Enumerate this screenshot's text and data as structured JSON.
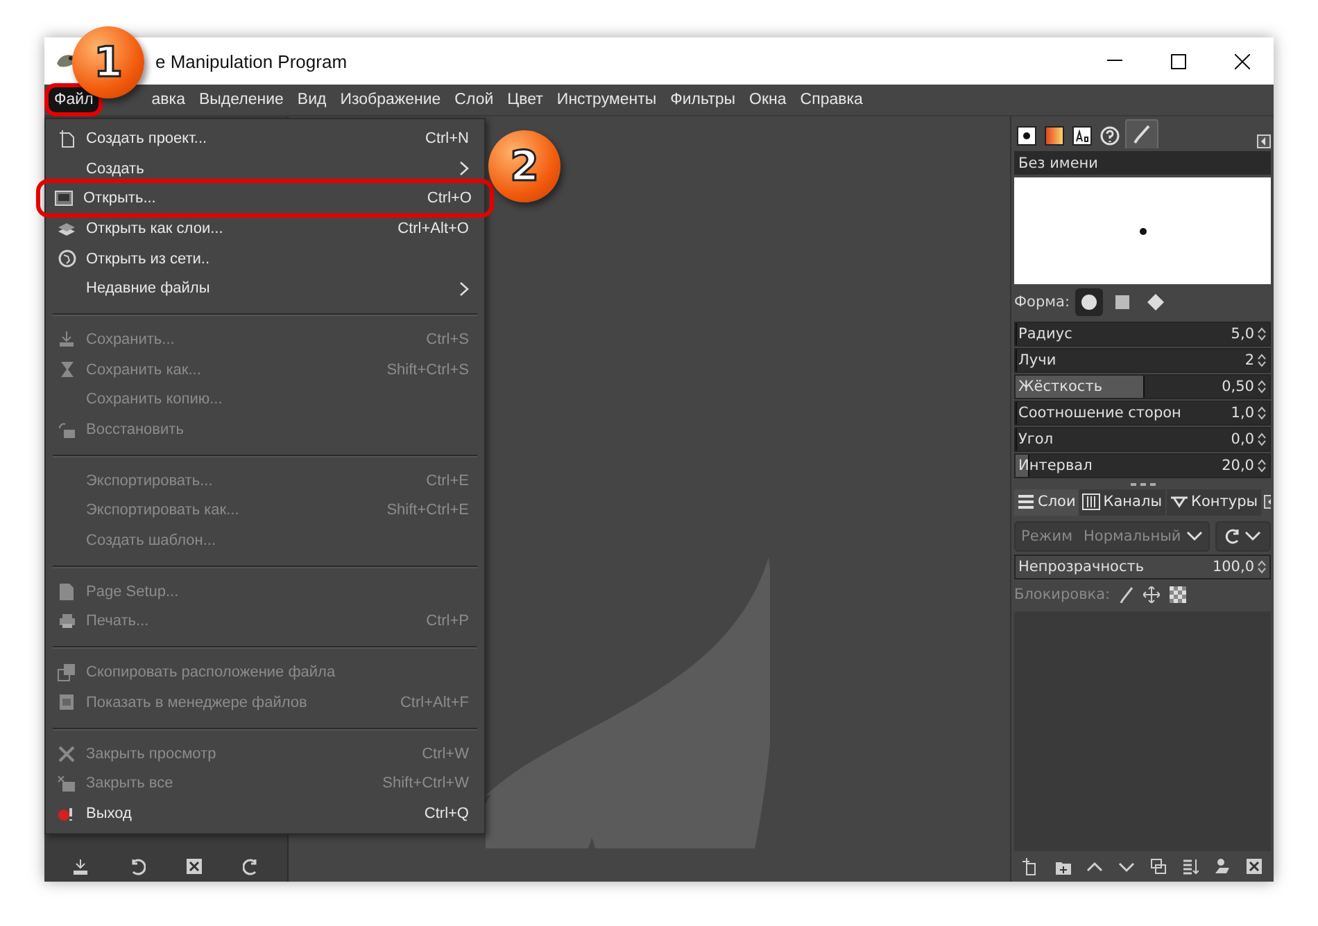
{
  "window": {
    "title": "e Manipulation Program"
  },
  "callouts": [
    {
      "label": "1"
    },
    {
      "label": "2"
    }
  ],
  "menubar": [
    {
      "label": "Файл",
      "selected": true,
      "annotated": true
    },
    {
      "label": "авка",
      "selected": false,
      "annotated": false
    },
    {
      "label": "Выделение",
      "selected": false,
      "annotated": false
    },
    {
      "label": "Вид",
      "selected": false,
      "annotated": false
    },
    {
      "label": "Изображение",
      "selected": false,
      "annotated": false
    },
    {
      "label": "Слой",
      "selected": false,
      "annotated": false
    },
    {
      "label": "Цвет",
      "selected": false,
      "annotated": false
    },
    {
      "label": "Инструменты",
      "selected": false,
      "annotated": false
    },
    {
      "label": "Фильтры",
      "selected": false,
      "annotated": false
    },
    {
      "label": "Окна",
      "selected": false,
      "annotated": false
    },
    {
      "label": "Справка",
      "selected": false,
      "annotated": false
    }
  ],
  "file_menu": [
    {
      "kind": "item",
      "label": "Создать проект...",
      "shortcut": "Ctrl+N",
      "disabled": false,
      "submenu": false,
      "annotated": false
    },
    {
      "kind": "item",
      "label": "Создать",
      "disabled": false,
      "submenu": true,
      "annotated": false
    },
    {
      "kind": "item",
      "label": "Открыть...",
      "shortcut": "Ctrl+O",
      "disabled": false,
      "submenu": false,
      "annotated": true
    },
    {
      "kind": "item",
      "label": "Открыть как слои...",
      "shortcut": "Ctrl+Alt+O",
      "disabled": false,
      "submenu": false,
      "annotated": false
    },
    {
      "kind": "item",
      "label": "Открыть из сети..",
      "disabled": false,
      "submenu": false,
      "annotated": false
    },
    {
      "kind": "item",
      "label": "Недавние файлы",
      "disabled": false,
      "submenu": true,
      "annotated": false
    },
    {
      "kind": "separator"
    },
    {
      "kind": "item",
      "label": "Сохранить...",
      "shortcut": "Ctrl+S",
      "disabled": true,
      "submenu": false,
      "annotated": false
    },
    {
      "kind": "item",
      "label": "Сохранить как...",
      "shortcut": "Shift+Ctrl+S",
      "disabled": true,
      "submenu": false,
      "annotated": false
    },
    {
      "kind": "item",
      "label": "Сохранить копию...",
      "disabled": true,
      "submenu": false,
      "annotated": false
    },
    {
      "kind": "item",
      "label": "Восстановить",
      "disabled": true,
      "submenu": false,
      "annotated": false
    },
    {
      "kind": "separator"
    },
    {
      "kind": "item",
      "label": "Экспортировать...",
      "shortcut": "Ctrl+E",
      "disabled": true,
      "submenu": false,
      "annotated": false
    },
    {
      "kind": "item",
      "label": "Экспортировать как...",
      "shortcut": "Shift+Ctrl+E",
      "disabled": true,
      "submenu": false,
      "annotated": false
    },
    {
      "kind": "item",
      "label": "Создать шаблон...",
      "disabled": true,
      "submenu": false,
      "annotated": false
    },
    {
      "kind": "separator"
    },
    {
      "kind": "item",
      "label": "Page Setup...",
      "disabled": true,
      "submenu": false,
      "annotated": false
    },
    {
      "kind": "item",
      "label": "Печать...",
      "shortcut": "Ctrl+P",
      "disabled": true,
      "submenu": false,
      "annotated": false
    },
    {
      "kind": "separator"
    },
    {
      "kind": "item",
      "label": "Скопировать расположение файла",
      "disabled": true,
      "submenu": false,
      "annotated": false
    },
    {
      "kind": "item",
      "label": "Показать в менеджере файлов",
      "shortcut": "Ctrl+Alt+F",
      "disabled": true,
      "submenu": false,
      "annotated": false
    },
    {
      "kind": "separator"
    },
    {
      "kind": "item",
      "label": "Закрыть просмотр",
      "shortcut": "Ctrl+W",
      "disabled": true,
      "submenu": false,
      "annotated": false
    },
    {
      "kind": "item",
      "label": "Закрыть все",
      "shortcut": "Shift+Ctrl+W",
      "disabled": true,
      "submenu": false,
      "annotated": false
    },
    {
      "kind": "item",
      "label": "Выход",
      "shortcut": "Ctrl+Q",
      "disabled": false,
      "submenu": false,
      "annotated": false
    }
  ],
  "brush_tabs": [
    {
      "kind": "brush",
      "selected": false
    },
    {
      "kind": "gradient",
      "selected": false
    },
    {
      "kind": "font",
      "selected": false
    },
    {
      "kind": "help",
      "selected": false
    },
    {
      "kind": "paintbrush",
      "selected": true
    }
  ],
  "brush_name": "Без имени",
  "shape": {
    "label": "Форма:",
    "options": [
      {
        "kind": "circle",
        "selected": true
      },
      {
        "kind": "square",
        "selected": false
      },
      {
        "kind": "diamond",
        "selected": false
      }
    ]
  },
  "brush_sliders": [
    {
      "label": "Радиус",
      "value": "5,0",
      "level": 0
    },
    {
      "label": "Лучи",
      "value": "2",
      "level": 0
    },
    {
      "label": "Жёсткость",
      "value": "0,50",
      "level": 0.5
    },
    {
      "label": "Соотношение сторон",
      "value": "1,0",
      "level": 0
    },
    {
      "label": "Угол",
      "value": "0,0",
      "level": 0
    },
    {
      "label": "Интервал",
      "value": "20,0",
      "level": 0.05
    }
  ],
  "layer_tabs": [
    {
      "kind": "layers",
      "label": "Слои",
      "selected": true
    },
    {
      "kind": "channels",
      "label": "Каналы",
      "selected": false
    },
    {
      "kind": "paths",
      "label": "Контуры",
      "selected": false
    }
  ],
  "mode": {
    "label": "Режим",
    "value": "Нормальный",
    "disabled": true
  },
  "opacity": {
    "label": "Непрозрачность",
    "value": "100,0",
    "level": 1
  },
  "lock": {
    "label": "Блокировка:"
  }
}
